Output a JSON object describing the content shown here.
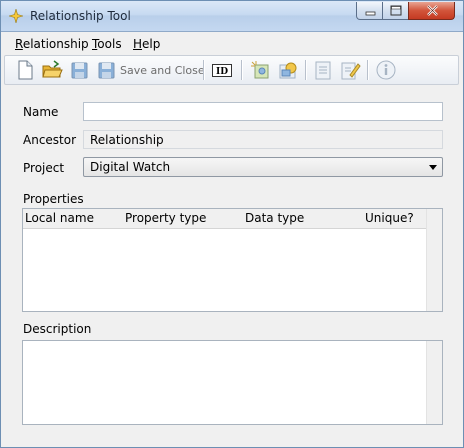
{
  "window": {
    "title": "Relationship Tool"
  },
  "menu": {
    "items": [
      {
        "underline": "R",
        "rest": "elationship"
      },
      {
        "underline": "T",
        "rest": "ools"
      },
      {
        "underline": "H",
        "rest": "elp"
      }
    ]
  },
  "toolbar": {
    "save_close_label": "Save and Close"
  },
  "form": {
    "name_label": "Name",
    "name_value": "",
    "ancestor_label": "Ancestor",
    "ancestor_value": "Relationship",
    "project_label": "Project",
    "project_value": "Digital Watch"
  },
  "properties": {
    "section_label": "Properties",
    "columns": [
      "Local name",
      "Property type",
      "Data type",
      "Unique?"
    ],
    "rows": []
  },
  "description": {
    "section_label": "Description",
    "value": ""
  }
}
